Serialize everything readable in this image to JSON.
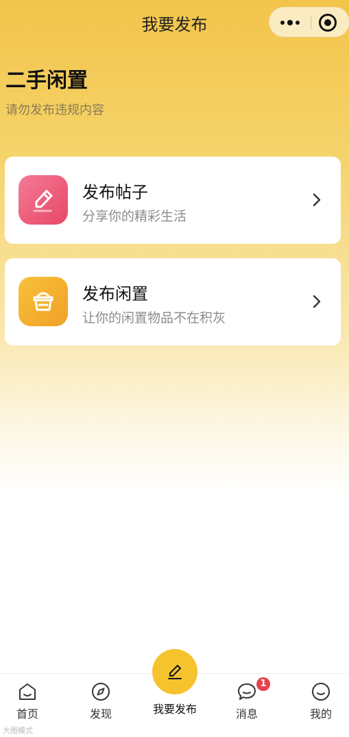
{
  "nav": {
    "title": "我要发布"
  },
  "header": {
    "title": "二手闲置",
    "subtitle": "请勿发布违规内容"
  },
  "cards": [
    {
      "title": "发布帖子",
      "desc": "分享你的精彩生活",
      "icon": "pencil-icon",
      "color": "#ec5a78"
    },
    {
      "title": "发布闲置",
      "desc": "让你的闲置物品不在积灰",
      "icon": "basket-icon",
      "color": "#f3ae2e"
    }
  ],
  "tabbar": {
    "items": [
      {
        "label": "首页",
        "icon": "home-icon"
      },
      {
        "label": "发现",
        "icon": "compass-icon"
      },
      {
        "label": "我要发布",
        "icon": "pencil-icon"
      },
      {
        "label": "消息",
        "icon": "chat-icon",
        "badge": "1"
      },
      {
        "label": "我的",
        "icon": "smile-icon"
      }
    ],
    "accent": "#f5c32e"
  },
  "watermark": "大图模式"
}
